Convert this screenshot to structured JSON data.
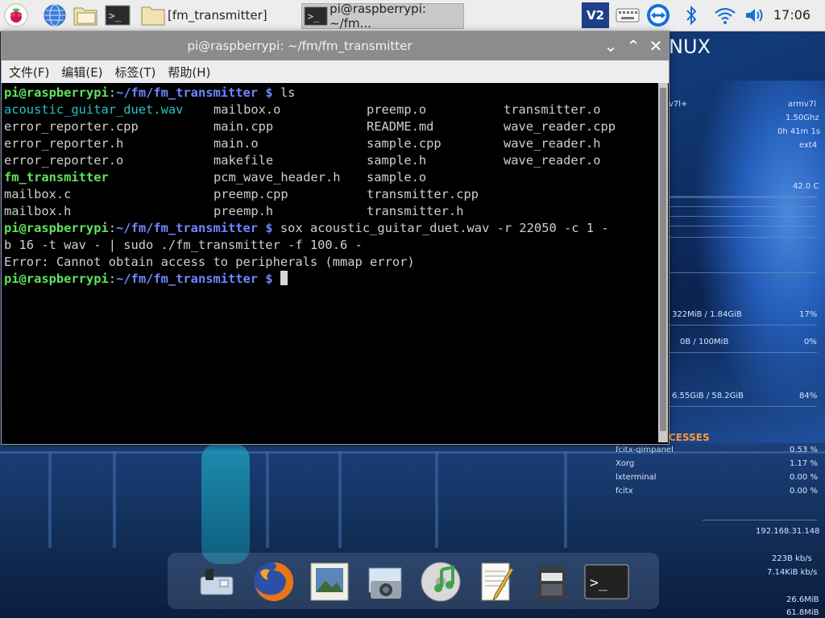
{
  "panel": {
    "taskbar_items": [
      {
        "label": "[fm_transmitter]"
      },
      {
        "label": "pi@raspberrypi: ~/fm..."
      }
    ],
    "clock": "17:06"
  },
  "terminal_window": {
    "title": "pi@raspberrypi: ~/fm/fm_transmitter",
    "menu": [
      "文件(F)",
      "编辑(E)",
      "标签(T)",
      "帮助(H)"
    ],
    "prompt": {
      "user_host": "pi@raspberrypi",
      "sep": ":",
      "path": "~/fm/fm_transmitter",
      "symbol": " $ "
    },
    "commands": [
      "ls",
      "sox acoustic_guitar_duet.wav -r 22050 -c 1 -",
      "b 16 -t wav - | sudo ./fm_transmitter -f 100.6 -"
    ],
    "ls_rows": [
      [
        "acoustic_guitar_duet.wav",
        "mailbox.o",
        "preemp.o",
        "transmitter.o"
      ],
      [
        "error_reporter.cpp",
        "main.cpp",
        "README.md",
        "wave_reader.cpp"
      ],
      [
        "error_reporter.h",
        "main.o",
        "sample.cpp",
        "wave_reader.h"
      ],
      [
        "error_reporter.o",
        "makefile",
        "sample.h",
        "wave_reader.o"
      ],
      [
        "fm_transmitter",
        "pcm_wave_header.h",
        "sample.o",
        ""
      ],
      [
        "mailbox.c",
        "preemp.cpp",
        "transmitter.cpp",
        ""
      ],
      [
        "mailbox.h",
        "preemp.h",
        "transmitter.h",
        ""
      ]
    ],
    "error_line": "Error: Cannot obtain access to peripherals (mmap error)"
  },
  "conky": {
    "title": "NUX",
    "arch": "armv7l",
    "arch_partial": "v7l+",
    "freq": "1.50Ghz",
    "uptime": "0h 41m 1s",
    "fs": "ext4",
    "temp": "42.0 C",
    "ram": "322MiB / 1.84GiB",
    "ram_pct": "17%",
    "swap": "0B  / 100MiB",
    "swap_pct": "0%",
    "disk": "6.55GiB / 58.2GiB",
    "disk_pct": "84%",
    "processes_label": "CESSES",
    "processes": [
      {
        "name": "fcitx-qimpanel",
        "pct": "0.53 %"
      },
      {
        "name": "Xorg",
        "pct": "1.17 %"
      },
      {
        "name": "lxterminal",
        "pct": "0.00 %"
      },
      {
        "name": "fcitx",
        "pct": "0.00 %"
      }
    ],
    "ip": "192.168.31.148",
    "net_up": "223B  kb/s",
    "net_down": "7.14KiB kb/s",
    "net_total_up": "26.6MiB",
    "net_total_down": "61.8MiB"
  },
  "colors": {
    "prompt_user": "#5fe35f",
    "prompt_path": "#6f86ff",
    "wav_file": "#27c3c3",
    "exec_file": "#5fe35f",
    "process_header": "#ff9a3c"
  }
}
